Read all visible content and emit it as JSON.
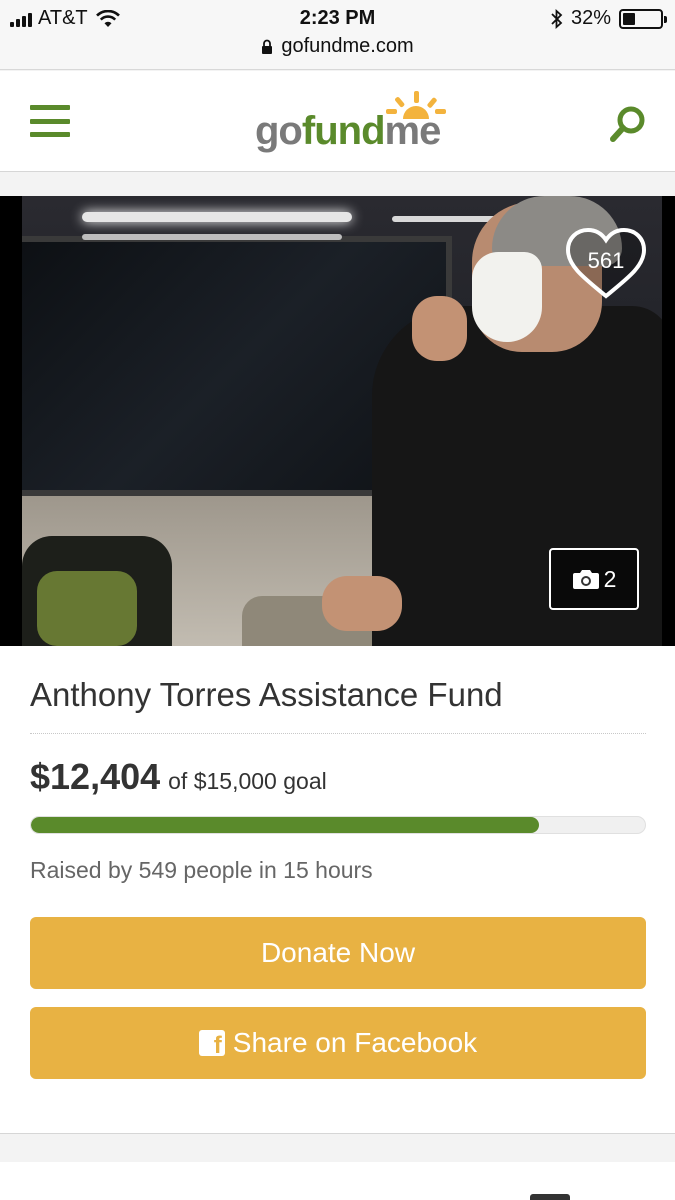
{
  "status_bar": {
    "carrier": "AT&T",
    "time": "2:23 PM",
    "battery_percent": "32%",
    "battery_level": 0.32,
    "url": "gofundme.com",
    "icons": [
      "signal-icon",
      "wifi-icon",
      "bluetooth-icon",
      "battery-icon",
      "lock-icon"
    ]
  },
  "header": {
    "logo": {
      "part1": "go",
      "part2": "fund",
      "part3": "me"
    },
    "menu_icon": "hamburger-menu-icon",
    "search_icon": "search-icon"
  },
  "campaign": {
    "heart_count": "561",
    "photo_count": "2",
    "title": "Anthony Torres Assistance Fund",
    "amount_raised": "$12,404",
    "goal_text": "of $15,000 goal",
    "progress_fraction": 0.827,
    "raised_by": "Raised by 549 people in 15 hours"
  },
  "buttons": {
    "donate": "Donate Now",
    "share": "Share on Facebook"
  },
  "colors": {
    "brand_green": "#5a8a2b",
    "button_yellow": "#e8b243"
  }
}
